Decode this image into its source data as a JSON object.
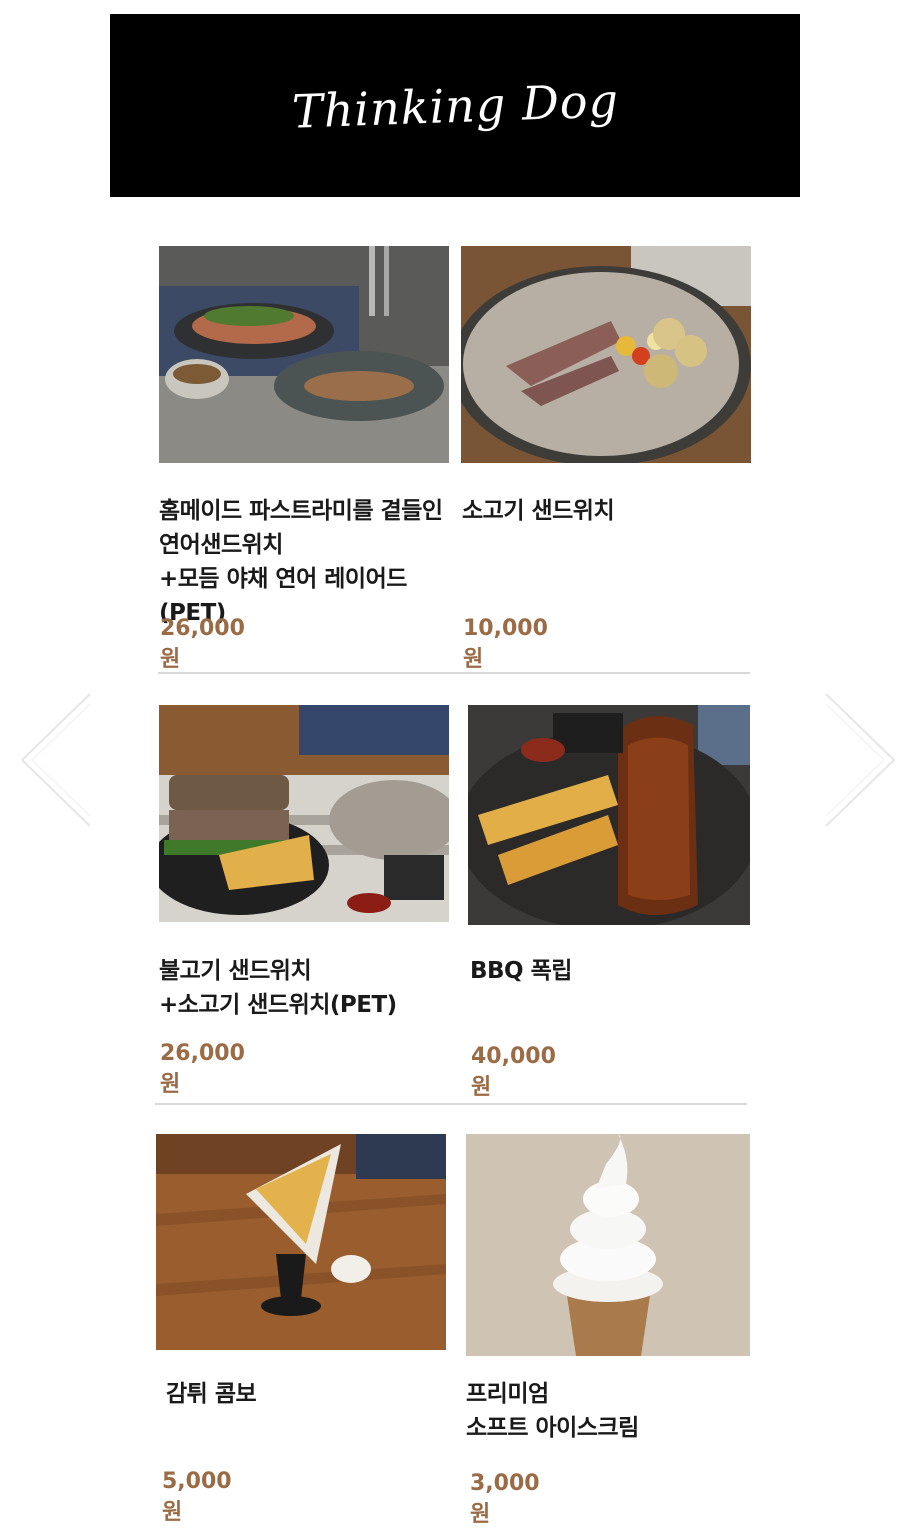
{
  "header": {
    "logo_text": "Thinking Dog"
  },
  "products": [
    {
      "name": "홈메이드 파스트라미를 곁들인\n연어샌드위치\n+모듬 야채 연어 레이어드(PET)",
      "price": "26,000원"
    },
    {
      "name": "소고기 샌드위치",
      "price": "10,000원"
    },
    {
      "name": "불고기 샌드위치\n+소고기 샌드위치(PET)",
      "price": "26,000원"
    },
    {
      "name": "BBQ 폭립",
      "price": "40,000원"
    },
    {
      "name": "감튀 콤보",
      "price": "5,000원"
    },
    {
      "name": "프리미엄\n소프트 아이스크림",
      "price": "3,000원"
    }
  ],
  "navigation": {
    "prev_icon": "chevron-left-icon",
    "next_icon": "chevron-right-icon"
  },
  "colors": {
    "header_bg": "#000000",
    "price": "#9a6b45",
    "divider": "#d9d9d9"
  }
}
